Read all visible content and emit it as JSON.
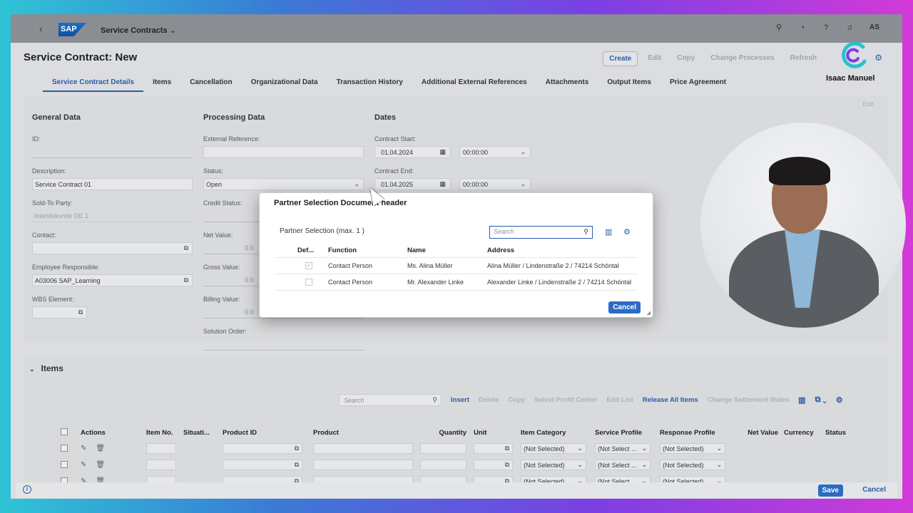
{
  "shell": {
    "app_title": "Service Contracts",
    "avatar_initials": "AS"
  },
  "header": {
    "title": "Service Contract: New",
    "actions": [
      "Create",
      "Edit",
      "Copy",
      "Change Processes",
      "Refresh"
    ]
  },
  "tabs": [
    "Service Contract Details",
    "Items",
    "Cancellation",
    "Organizational Data",
    "Transaction History",
    "Additional External References",
    "Attachments",
    "Output Items",
    "Price Agreement"
  ],
  "details": {
    "edit_label": "Edit",
    "general": {
      "heading": "General Data",
      "id_label": "ID:",
      "id_value": "",
      "description_label": "Description:",
      "description_value": "Service Contract 01",
      "sold_to_label": "Sold-To Party:",
      "sold_to_value": "Inlandskunde DE 1",
      "contact_label": "Contact:",
      "employee_label": "Employee Responsible:",
      "employee_value": "A03006 SAP_Learning",
      "wbs_label": "WBS Element:"
    },
    "processing": {
      "heading": "Processing Data",
      "external_ref_label": "External Reference:",
      "status_label": "Status:",
      "status_value": "Open",
      "credit_status_label": "Credit Status:",
      "net_value_label": "Net Value:",
      "net_value": "0.0",
      "gross_value_label": "Gross Value:",
      "gross_value": "0.0",
      "billing_value_label": "Billing Value:",
      "billing_value": "0.0",
      "solution_order_label": "Solution Order:"
    },
    "dates": {
      "heading": "Dates",
      "start_label": "Contract Start:",
      "start_date": "01.04.2024",
      "start_time": "00:00:00",
      "end_label": "Contract End:",
      "end_date": "01.04.2025",
      "end_time": "00:00:00"
    }
  },
  "dialog": {
    "title": "Partner Selection Document header",
    "subtitle": "Partner Selection (max. 1 )",
    "search_placeholder": "Search",
    "columns": [
      "Def...",
      "Function",
      "Name",
      "Address"
    ],
    "rows": [
      {
        "function": "Contact Person",
        "name": "Ms. Alina Müller",
        "address": "Alina Müller / Lindenstraße 2 / 74214 Schöntal",
        "default": true
      },
      {
        "function": "Contact Person",
        "name": "Mr. Alexander Linke",
        "address": "Alexander Linke / Lindenstraße 2 / 74214 Schöntal",
        "default": false
      }
    ],
    "cancel_label": "Cancel"
  },
  "items": {
    "title": "Items",
    "search_placeholder": "Search",
    "toolbar": [
      "Insert",
      "Delete",
      "Copy",
      "Select Profit Center",
      "Edit List",
      "Release All Items",
      "Change Settlement Rules"
    ],
    "columns": [
      "Actions",
      "Item No.",
      "Situati...",
      "Product ID",
      "Product",
      "Quantity",
      "Unit",
      "Item Category",
      "Service Profile",
      "Response Profile",
      "Net Value",
      "Currency",
      "Status"
    ],
    "rows": [
      {
        "item_category": "(Not Selected)",
        "service_profile": "(Not Select ...",
        "response_profile": "(Not Selected)"
      },
      {
        "item_category": "(Not Selected)",
        "service_profile": "(Not Select ...",
        "response_profile": "(Not Selected)"
      },
      {
        "item_category": "(Not Selected)",
        "service_profile": "(Not Select ...",
        "response_profile": "(Not Selected)"
      }
    ]
  },
  "footer": {
    "save_label": "Save",
    "cancel_label": "Cancel"
  },
  "overlay": {
    "presenter_name": "Isaac Manuel"
  },
  "colors": {
    "accent": "#2a5ba8",
    "primary_button": "#2a6cc4"
  }
}
